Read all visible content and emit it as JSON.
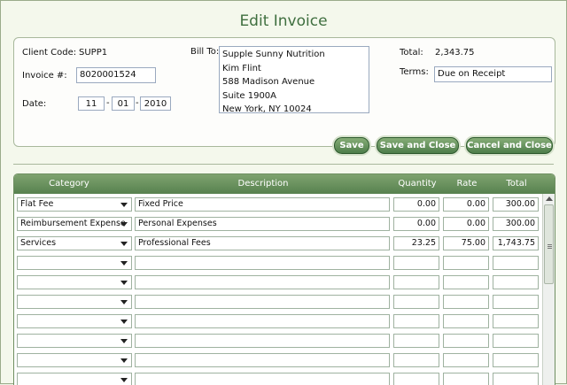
{
  "title": "Edit Invoice",
  "client": {
    "label": "Client Code:",
    "value": "SUPP1"
  },
  "invoice": {
    "label": "Invoice #:",
    "value": "8020001524"
  },
  "date": {
    "label": "Date:",
    "month": "11",
    "day": "01",
    "year": "2010",
    "sep": "-"
  },
  "billto": {
    "label": "Bill To:",
    "lines": [
      "Supple Sunny Nutrition",
      "Kim Flint",
      "588 Madison Avenue",
      "Suite 1900A",
      "New York, NY  10024"
    ]
  },
  "total": {
    "label": "Total:",
    "value": "2,343.75"
  },
  "terms": {
    "label": "Terms:",
    "value": "Due on Receipt"
  },
  "buttons": {
    "save": "Save",
    "save_close": "Save and Close",
    "cancel_close": "Cancel and Close"
  },
  "grid": {
    "headers": {
      "category": "Category",
      "description": "Description",
      "quantity": "Quantity",
      "rate": "Rate",
      "total": "Total"
    },
    "rows": [
      {
        "category": "Flat Fee",
        "description": "Fixed Price",
        "quantity": "0.00",
        "rate": "0.00",
        "total": "300.00"
      },
      {
        "category": "Reimbursement Expense",
        "description": "Personal Expenses",
        "quantity": "0.00",
        "rate": "0.00",
        "total": "300.00"
      },
      {
        "category": "Services",
        "description": "Professional Fees",
        "quantity": "23.25",
        "rate": "75.00",
        "total": "1,743.75"
      },
      {
        "category": "",
        "description": "",
        "quantity": "",
        "rate": "",
        "total": ""
      },
      {
        "category": "",
        "description": "",
        "quantity": "",
        "rate": "",
        "total": ""
      },
      {
        "category": "",
        "description": "",
        "quantity": "",
        "rate": "",
        "total": ""
      },
      {
        "category": "",
        "description": "",
        "quantity": "",
        "rate": "",
        "total": ""
      },
      {
        "category": "",
        "description": "",
        "quantity": "",
        "rate": "",
        "total": ""
      },
      {
        "category": "",
        "description": "",
        "quantity": "",
        "rate": "",
        "total": ""
      },
      {
        "category": "",
        "description": "",
        "quantity": "",
        "rate": "",
        "total": ""
      }
    ]
  }
}
